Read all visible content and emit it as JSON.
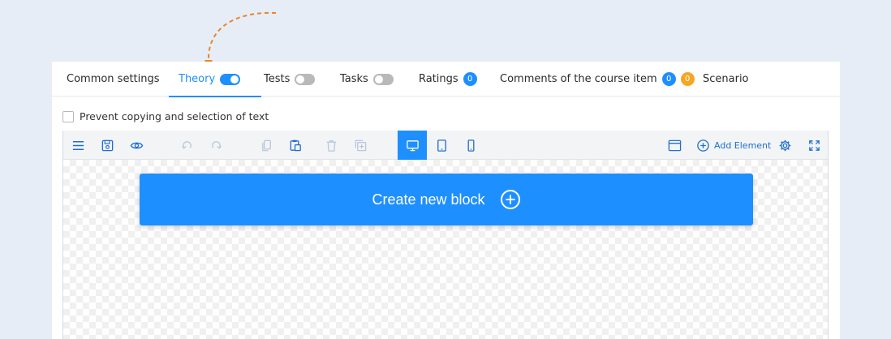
{
  "tabs": [
    {
      "label": "Common settings"
    },
    {
      "label": "Theory",
      "toggle": "on"
    },
    {
      "label": "Tests",
      "toggle": "off"
    },
    {
      "label": "Tasks",
      "toggle": "off"
    },
    {
      "label": "Ratings",
      "badges": [
        "0"
      ]
    },
    {
      "label": "Comments of the course item",
      "badges": [
        "0",
        "0"
      ]
    },
    {
      "label": "Scenario"
    }
  ],
  "prevent_copy": {
    "label": "Prevent copying and selection of text",
    "checked": false
  },
  "toolbar": {
    "add_element_label": "Add Element",
    "icons": [
      "menu-icon",
      "save-icon",
      "preview-eye-icon",
      "undo-icon",
      "redo-icon",
      "copy-icon",
      "paste-icon",
      "delete-icon",
      "duplicate-icon",
      "desktop-view-icon",
      "tablet-view-icon",
      "mobile-view-icon",
      "window-icon",
      "add-element-icon",
      "settings-gear-icon",
      "fullscreen-icon"
    ],
    "active_view": "desktop"
  },
  "canvas": {
    "create_block_label": "Create new block"
  },
  "colors": {
    "accent": "#1e8fff",
    "badge_orange": "#f5a623",
    "background": "#e6edf6",
    "arrow": "#e8862a"
  }
}
